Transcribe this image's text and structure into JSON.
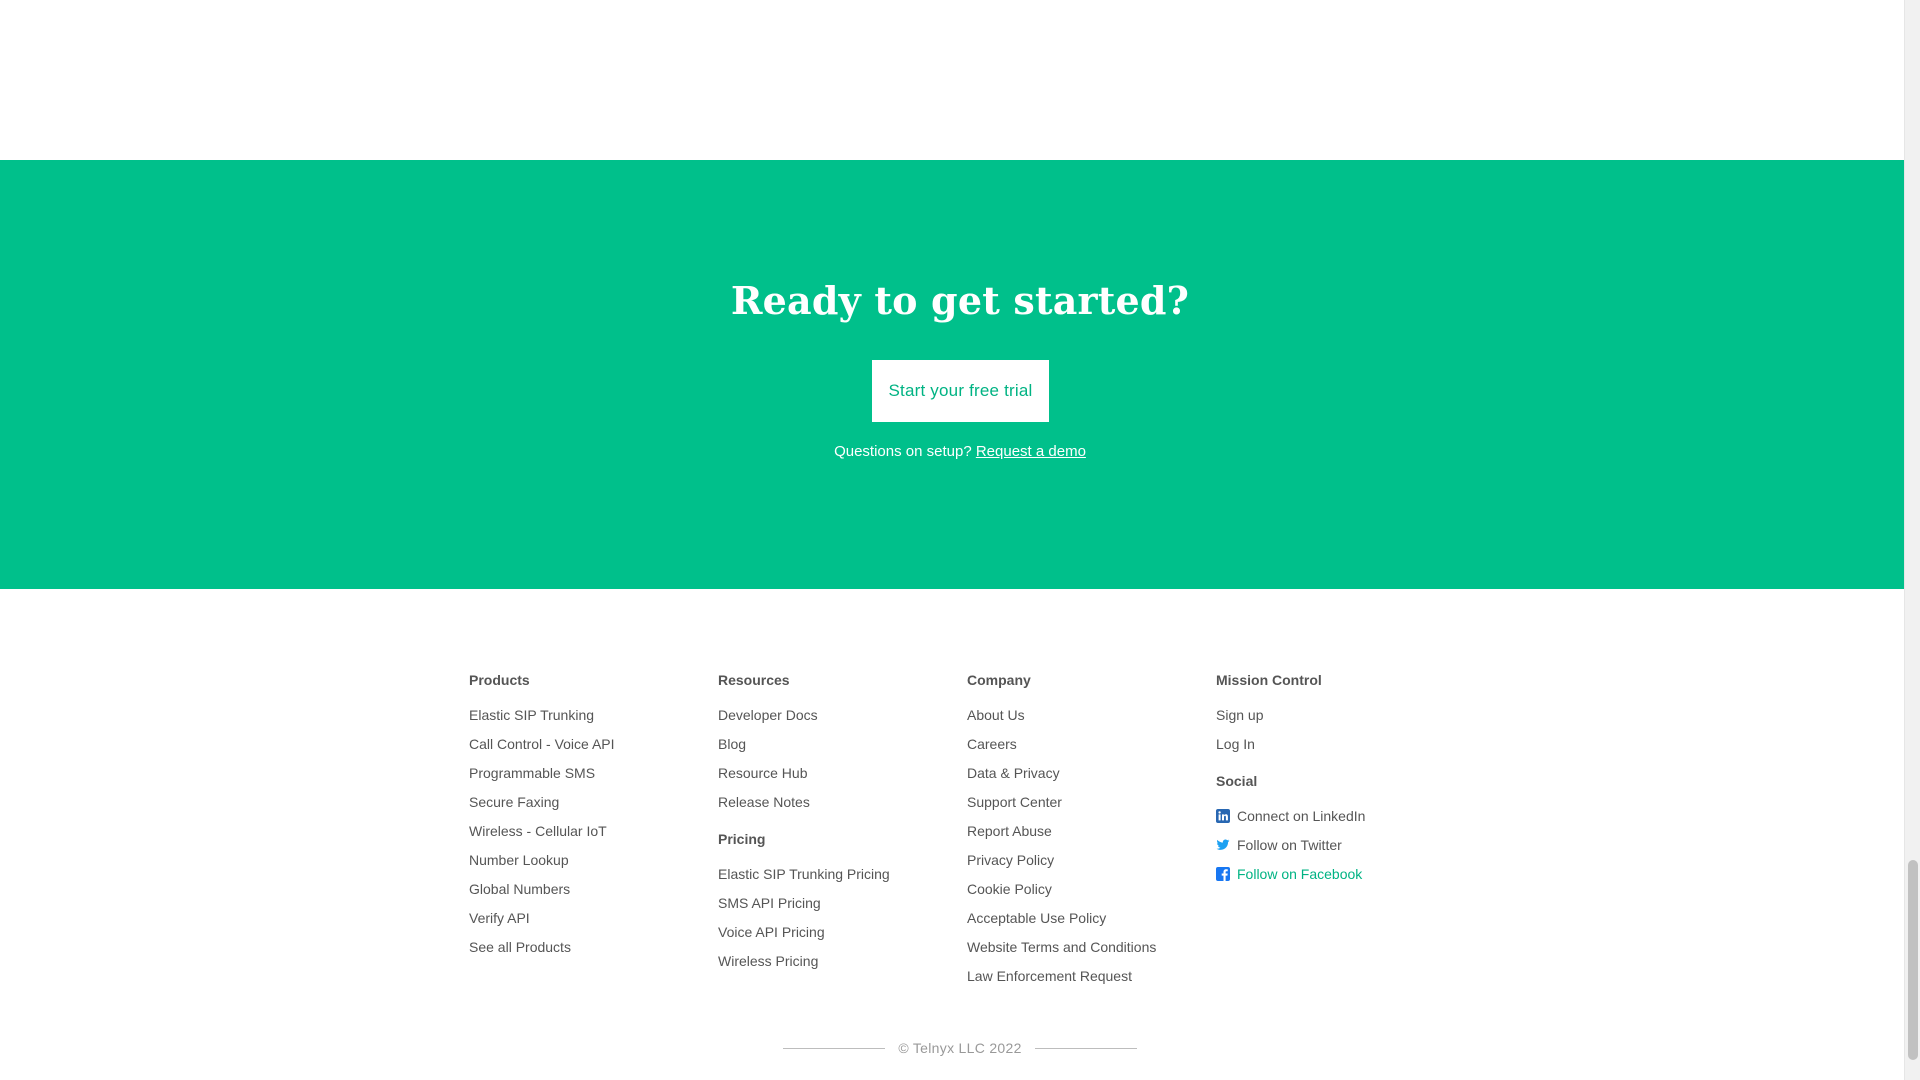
{
  "cta": {
    "heading": "Ready to get started?",
    "button_label": "Start your free trial",
    "question_text": "Questions on setup? ",
    "demo_link": "Request a demo"
  },
  "footer": {
    "products": {
      "heading": "Products",
      "items": [
        "Elastic SIP Trunking",
        "Call Control - Voice API",
        "Programmable SMS",
        "Secure Faxing",
        "Wireless - Cellular IoT",
        "Number Lookup",
        "Global Numbers",
        "Verify API",
        "See all Products"
      ]
    },
    "resources": {
      "heading": "Resources",
      "items": [
        "Developer Docs",
        "Blog",
        "Resource Hub",
        "Release Notes"
      ]
    },
    "pricing": {
      "heading": "Pricing",
      "items": [
        "Elastic SIP Trunking Pricing",
        "SMS API Pricing",
        "Voice API Pricing",
        "Wireless Pricing"
      ]
    },
    "company": {
      "heading": "Company",
      "items": [
        "About Us",
        "Careers",
        "Data & Privacy",
        "Support Center",
        "Report Abuse",
        "Privacy Policy",
        "Cookie Policy",
        "Acceptable Use Policy",
        "Website Terms and Conditions",
        "Law Enforcement Request"
      ]
    },
    "mission_control": {
      "heading": "Mission Control",
      "items": [
        "Sign up",
        "Log In"
      ]
    },
    "social": {
      "heading": "Social",
      "items": [
        {
          "label": "Connect on LinkedIn",
          "icon": "linkedin-icon"
        },
        {
          "label": "Follow on Twitter",
          "icon": "twitter-icon"
        },
        {
          "label": "Follow on Facebook",
          "icon": "facebook-icon"
        }
      ]
    },
    "copyright": "© Telnyx LLC 2022"
  },
  "colors": {
    "brand_green": "#00c08b",
    "link_green": "#00b383",
    "linkedin_icon": "#2867b2",
    "twitter_icon": "#1da1f2",
    "facebook_icon": "#1877f2"
  }
}
